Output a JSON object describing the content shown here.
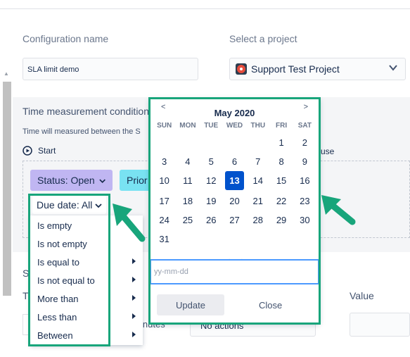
{
  "form": {
    "config_label": "Configuration name",
    "config_value": "SLA limit demo",
    "project_label": "Select a project",
    "project_value": "Support Test Project"
  },
  "time_measurement": {
    "title": "Time measurement condition",
    "description": "Time will measured between the S",
    "start_label": "Start",
    "pause_label": "use",
    "chips": {
      "status": "Status: Open",
      "priority": "Prior",
      "due_date": "Due date: All"
    }
  },
  "due_menu": {
    "items": [
      {
        "label": "Is empty",
        "submenu": false
      },
      {
        "label": "Is not empty",
        "submenu": false
      },
      {
        "label": "Is equal to",
        "submenu": true
      },
      {
        "label": "Is not equal to",
        "submenu": true
      },
      {
        "label": "More than",
        "submenu": true
      },
      {
        "label": "Less than",
        "submenu": true
      },
      {
        "label": "Between",
        "submenu": true
      }
    ]
  },
  "calendar": {
    "prev": "<",
    "next": ">",
    "month_title": "May 2020",
    "weekdays": [
      "SUN",
      "MON",
      "TUE",
      "WED",
      "THU",
      "FRI",
      "SAT"
    ],
    "leading_blanks": 5,
    "days_in_month": 31,
    "selected_day": 13,
    "input_placeholder": "yy-mm-dd",
    "update_label": "Update",
    "close_label": "Close"
  },
  "lower": {
    "section_label": "S",
    "t_label": "T",
    "minutes_label": "inutes",
    "actions_value": "No actions",
    "value_label": "Value"
  },
  "colors": {
    "highlight": "#18a57b",
    "selected_day": "#0052cc",
    "status_chip": "#c0b6f2",
    "priority_chip": "#79e2f2"
  }
}
